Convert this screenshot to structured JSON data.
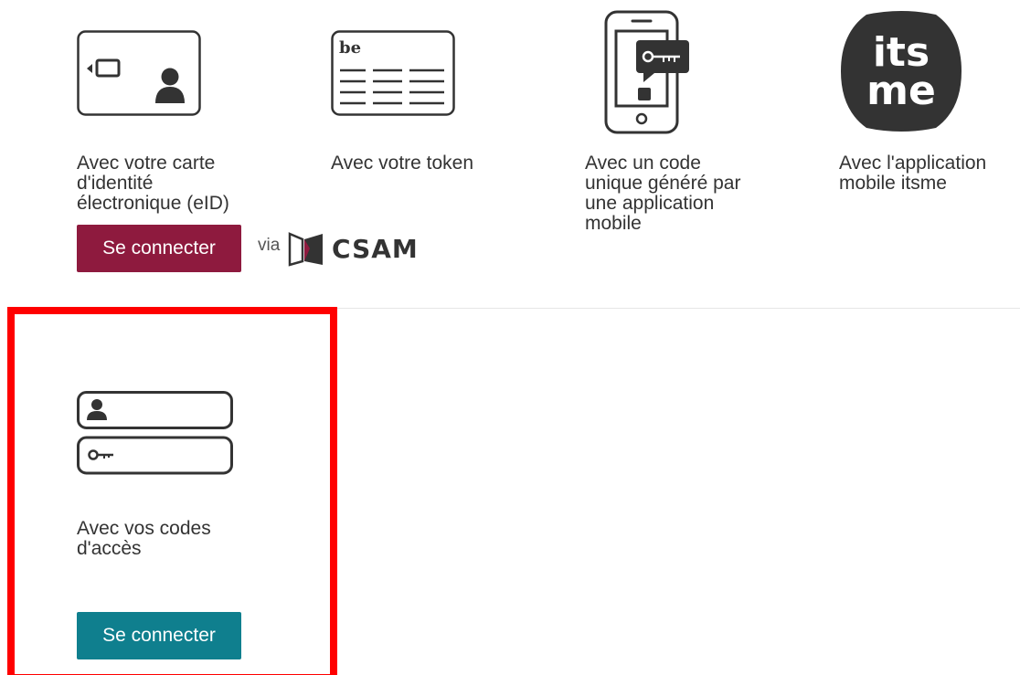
{
  "options": {
    "eid": {
      "label": "Avec votre carte\nd'identité\nélectronique (eID)",
      "button": "Se connecter",
      "via_label": "via",
      "csam_label": "CSAM"
    },
    "token": {
      "label": "Avec votre token",
      "card_text": "be"
    },
    "app_code": {
      "label": "Avec un code\nunique généré par\nune application\nmobile"
    },
    "itsme": {
      "label": "Avec l'application\nmobile itsme",
      "logo_top": "its",
      "logo_bottom": "me"
    },
    "access_codes": {
      "label": "Avec vos codes\nd'accès",
      "button": "Se connecter"
    }
  },
  "colors": {
    "eid_button": "#8e1a3e",
    "codes_button": "#0f7f8e",
    "highlight_border": "#ff0000",
    "icon_stroke": "#333333"
  }
}
